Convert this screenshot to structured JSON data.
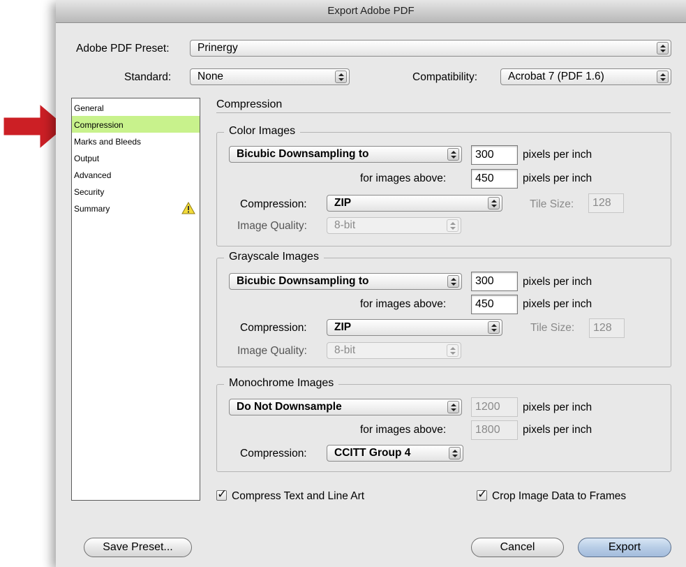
{
  "window": {
    "title": "Export Adobe PDF"
  },
  "header": {
    "preset_label": "Adobe PDF Preset:",
    "preset_value": "Prinergy",
    "standard_label": "Standard:",
    "standard_value": "None",
    "compatibility_label": "Compatibility:",
    "compatibility_value": "Acrobat 7 (PDF 1.6)"
  },
  "sidebar": {
    "items": [
      {
        "label": "General"
      },
      {
        "label": "Compression",
        "selected": true
      },
      {
        "label": "Marks and Bleeds"
      },
      {
        "label": "Output"
      },
      {
        "label": "Advanced"
      },
      {
        "label": "Security"
      },
      {
        "label": "Summary",
        "icon": "warning-icon"
      }
    ],
    "highlight_color": "#c8f28c"
  },
  "panel": {
    "title": "Compression"
  },
  "color_images": {
    "title": "Color Images",
    "downsample": "Bicubic Downsampling to",
    "ppi": "300",
    "ppi_unit": "pixels per inch",
    "above_label": "for images above:",
    "above": "450",
    "above_unit": "pixels per inch",
    "compression_label": "Compression:",
    "compression": "ZIP",
    "tile_label": "Tile Size:",
    "tile": "128",
    "quality_label": "Image Quality:",
    "quality": "8-bit"
  },
  "grayscale_images": {
    "title": "Grayscale Images",
    "downsample": "Bicubic Downsampling to",
    "ppi": "300",
    "ppi_unit": "pixels per inch",
    "above_label": "for images above:",
    "above": "450",
    "above_unit": "pixels per inch",
    "compression_label": "Compression:",
    "compression": "ZIP",
    "tile_label": "Tile Size:",
    "tile": "128",
    "quality_label": "Image Quality:",
    "quality": "8-bit"
  },
  "monochrome_images": {
    "title": "Monochrome Images",
    "downsample": "Do Not Downsample",
    "ppi": "1200",
    "ppi_unit": "pixels per inch",
    "above_label": "for images above:",
    "above": "1800",
    "above_unit": "pixels per inch",
    "compression_label": "Compression:",
    "compression": "CCITT Group 4"
  },
  "options": {
    "compress_text": {
      "label": "Compress Text and Line Art",
      "checked": true
    },
    "crop_image": {
      "label": "Crop Image Data to Frames",
      "checked": true
    }
  },
  "buttons": {
    "save_preset": "Save Preset...",
    "cancel": "Cancel",
    "export": "Export"
  },
  "colors": {
    "arrow": "#cc1f25",
    "selection": "#c8f28c"
  }
}
